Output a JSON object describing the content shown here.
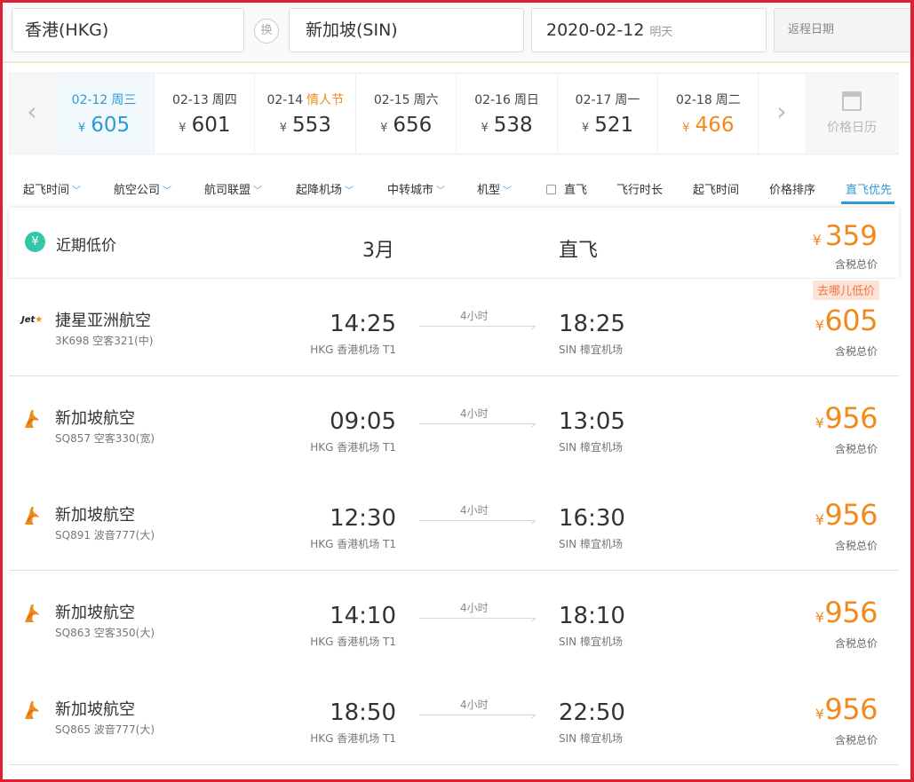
{
  "search": {
    "from": "香港(HKG)",
    "swap_label": "换",
    "to": "新加坡(SIN)",
    "date": "2020-02-12",
    "date_hint": "明天",
    "return_placeholder": "返程日期"
  },
  "date_strip": {
    "days": [
      {
        "date": "02-12",
        "weekday": "周三",
        "holiday": "",
        "price": "605",
        "currency": "¥"
      },
      {
        "date": "02-13",
        "weekday": "周四",
        "holiday": "",
        "price": "601",
        "currency": "¥"
      },
      {
        "date": "02-14",
        "weekday": "",
        "holiday": "情人节",
        "price": "553",
        "currency": "¥"
      },
      {
        "date": "02-15",
        "weekday": "周六",
        "holiday": "",
        "price": "656",
        "currency": "¥"
      },
      {
        "date": "02-16",
        "weekday": "周日",
        "holiday": "",
        "price": "538",
        "currency": "¥"
      },
      {
        "date": "02-17",
        "weekday": "周一",
        "holiday": "",
        "price": "521",
        "currency": "¥"
      },
      {
        "date": "02-18",
        "weekday": "周二",
        "holiday": "",
        "price": "466",
        "currency": "¥"
      }
    ],
    "selected_index": 0,
    "lowest_index": 6,
    "calendar_label": "价格日历"
  },
  "filters": {
    "dropdowns": [
      "起飞时间",
      "航空公司",
      "航司联盟",
      "起降机场",
      "中转城市",
      "机型"
    ],
    "direct_checkbox": "直飞",
    "sorts": [
      "飞行时长",
      "起飞时间",
      "价格排序",
      "直飞优先"
    ],
    "active_sort": "直飞优先"
  },
  "low_price": {
    "label": "近期低价",
    "icon_glyph": "¥",
    "month": "3月",
    "type": "直飞",
    "currency": "¥",
    "price": "359",
    "tax_label": "含税总价"
  },
  "flights": [
    {
      "airline": "捷星亚洲航空",
      "logo": "jetstar-logo",
      "logo_text": "Jet",
      "info": "3K698 空客321(中)",
      "dep_time": "14:25",
      "dep_airport": "HKG 香港机场 T1",
      "duration": "4小时",
      "arr_time": "18:25",
      "arr_airport": "SIN 樟宜机场",
      "currency": "¥",
      "price": "605",
      "tax_label": "含税总价",
      "badge": "去哪儿低价"
    },
    {
      "airline": "新加坡航空",
      "logo": "singapore-airlines-logo",
      "info": "SQ857 空客330(宽)",
      "dep_time": "09:05",
      "dep_airport": "HKG 香港机场 T1",
      "duration": "4小时",
      "arr_time": "13:05",
      "arr_airport": "SIN 樟宜机场",
      "currency": "¥",
      "price": "956",
      "tax_label": "含税总价",
      "badge": ""
    },
    {
      "airline": "新加坡航空",
      "logo": "singapore-airlines-logo",
      "info": "SQ891 波音777(大)",
      "dep_time": "12:30",
      "dep_airport": "HKG 香港机场 T1",
      "duration": "4小时",
      "arr_time": "16:30",
      "arr_airport": "SIN 樟宜机场",
      "currency": "¥",
      "price": "956",
      "tax_label": "含税总价",
      "badge": ""
    },
    {
      "airline": "新加坡航空",
      "logo": "singapore-airlines-logo",
      "info": "SQ863 空客350(大)",
      "dep_time": "14:10",
      "dep_airport": "HKG 香港机场 T1",
      "duration": "4小时",
      "arr_time": "18:10",
      "arr_airport": "SIN 樟宜机场",
      "currency": "¥",
      "price": "956",
      "tax_label": "含税总价",
      "badge": ""
    },
    {
      "airline": "新加坡航空",
      "logo": "singapore-airlines-logo",
      "info": "SQ865 波音777(大)",
      "dep_time": "18:50",
      "dep_airport": "HKG 香港机场 T1",
      "duration": "4小时",
      "arr_time": "22:50",
      "arr_airport": "SIN 樟宜机场",
      "currency": "¥",
      "price": "956",
      "tax_label": "含税总价",
      "badge": ""
    }
  ],
  "colors": {
    "accent_blue": "#2d9ad6",
    "price_orange": "#f08a1c",
    "frame_red": "#e02030",
    "lowprice_green": "#35c6a9"
  }
}
